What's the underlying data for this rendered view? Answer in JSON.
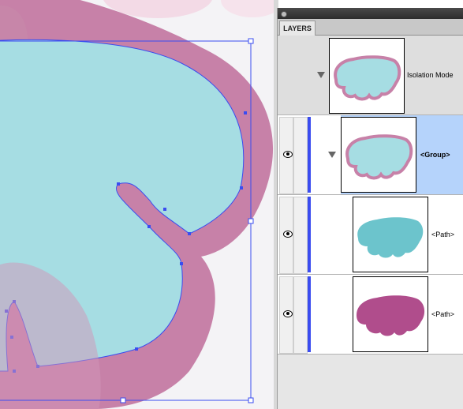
{
  "panel": {
    "tab_label": "LAYERS"
  },
  "rows": [
    {
      "label": "Isolation Mode",
      "type": "isolation"
    },
    {
      "label": "<Group>",
      "type": "group",
      "selected": true,
      "visible": true
    },
    {
      "label": "<Path>",
      "type": "path",
      "fill": "#6cc4cc",
      "visible": true
    },
    {
      "label": "<Path>",
      "type": "path",
      "fill": "#b04d8c",
      "visible": true
    }
  ],
  "colors": {
    "artwork_outer": "#c781a8",
    "artwork_inner": "#a6dde3",
    "selection": "#3a4cf0",
    "layer_color": "#3a4cf0",
    "selected_row": "#b5d3fb"
  }
}
